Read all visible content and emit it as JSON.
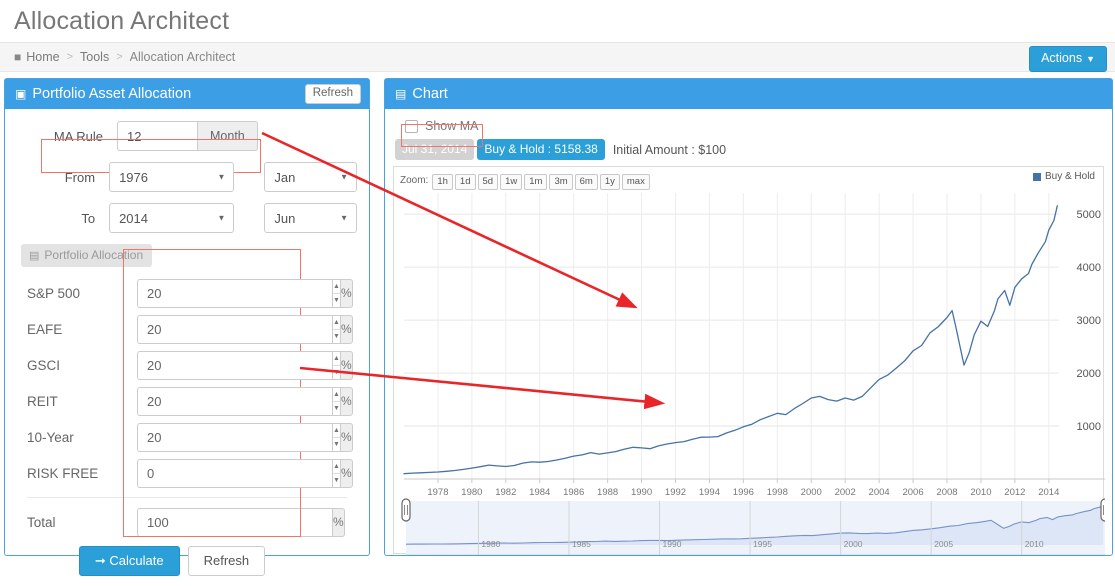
{
  "header": {
    "title": "Allocation Architect",
    "breadcrumb": {
      "home": "Home",
      "tools": "Tools",
      "current": "Allocation Architect",
      "separator": ">"
    },
    "actions_button": "Actions"
  },
  "left_panel": {
    "title": "Portfolio Asset Allocation",
    "refresh_label": "Refresh",
    "ma_rule": {
      "label": "MA Rule",
      "value": "12",
      "unit": "Month"
    },
    "from": {
      "label": "From",
      "year": "1976",
      "month": "Jan"
    },
    "to": {
      "label": "To",
      "year": "2014",
      "month": "Jun"
    },
    "allocation_tab": "Portfolio Allocation",
    "percent_sign": "%",
    "assets": [
      {
        "label": "S&P 500",
        "value": "20"
      },
      {
        "label": "EAFE",
        "value": "20"
      },
      {
        "label": "GSCI",
        "value": "20"
      },
      {
        "label": "REIT",
        "value": "20"
      },
      {
        "label": "10-Year",
        "value": "20"
      },
      {
        "label": "RISK FREE",
        "value": "0"
      }
    ],
    "total": {
      "label": "Total",
      "value": "100"
    },
    "calculate_label": "Calculate",
    "refresh_bottom_label": "Refresh"
  },
  "chart_panel": {
    "title": "Chart",
    "show_ma_label": "Show MA",
    "date_badge": "Jul 31, 2014",
    "result_badge": "Buy & Hold : 5158.38",
    "initial_amount": "Initial Amount : $100",
    "zoom_label": "Zoom:",
    "zoom_options": [
      "1h",
      "1d",
      "5d",
      "1w",
      "1m",
      "3m",
      "6m",
      "1y",
      "max"
    ],
    "legend": "Buy & Hold"
  },
  "colors": {
    "accent": "#2a9fd8",
    "panel_header": "#3c9ee5",
    "series": "#4572a7",
    "annotation": "#f0746a",
    "arrow": "#e8262a"
  },
  "chart_data": {
    "type": "line",
    "title": "Buy & Hold",
    "xlabel": "",
    "ylabel": "",
    "series": [
      {
        "name": "Buy & Hold",
        "color": "#4572a7",
        "points": [
          [
            1976.0,
            100
          ],
          [
            1976.5,
            112
          ],
          [
            1977.0,
            118
          ],
          [
            1977.5,
            124
          ],
          [
            1978.0,
            132
          ],
          [
            1978.5,
            146
          ],
          [
            1979.0,
            160
          ],
          [
            1979.5,
            182
          ],
          [
            1980.0,
            205
          ],
          [
            1980.5,
            232
          ],
          [
            1981.0,
            262
          ],
          [
            1981.5,
            248
          ],
          [
            1982.0,
            236
          ],
          [
            1982.5,
            255
          ],
          [
            1983.0,
            300
          ],
          [
            1983.5,
            322
          ],
          [
            1984.0,
            318
          ],
          [
            1984.5,
            330
          ],
          [
            1985.0,
            358
          ],
          [
            1985.5,
            392
          ],
          [
            1986.0,
            432
          ],
          [
            1986.5,
            455
          ],
          [
            1987.0,
            498
          ],
          [
            1987.5,
            470
          ],
          [
            1988.0,
            492
          ],
          [
            1988.5,
            520
          ],
          [
            1989.0,
            565
          ],
          [
            1989.5,
            598
          ],
          [
            1990.0,
            588
          ],
          [
            1990.5,
            572
          ],
          [
            1991.0,
            625
          ],
          [
            1991.5,
            660
          ],
          [
            1992.0,
            688
          ],
          [
            1992.5,
            706
          ],
          [
            1993.0,
            752
          ],
          [
            1993.5,
            790
          ],
          [
            1994.0,
            792
          ],
          [
            1994.5,
            800
          ],
          [
            1995.0,
            868
          ],
          [
            1995.5,
            920
          ],
          [
            1996.0,
            985
          ],
          [
            1996.5,
            1035
          ],
          [
            1997.0,
            1120
          ],
          [
            1997.5,
            1180
          ],
          [
            1998.0,
            1240
          ],
          [
            1998.5,
            1215
          ],
          [
            1999.0,
            1330
          ],
          [
            1999.5,
            1425
          ],
          [
            2000.0,
            1530
          ],
          [
            2000.5,
            1560
          ],
          [
            2001.0,
            1500
          ],
          [
            2001.5,
            1470
          ],
          [
            2002.0,
            1530
          ],
          [
            2002.5,
            1490
          ],
          [
            2003.0,
            1560
          ],
          [
            2003.5,
            1720
          ],
          [
            2004.0,
            1880
          ],
          [
            2004.5,
            1960
          ],
          [
            2005.0,
            2090
          ],
          [
            2005.5,
            2230
          ],
          [
            2006.0,
            2420
          ],
          [
            2006.5,
            2520
          ],
          [
            2007.0,
            2760
          ],
          [
            2007.5,
            2880
          ],
          [
            2008.0,
            3050
          ],
          [
            2008.3,
            3180
          ],
          [
            2008.5,
            2900
          ],
          [
            2008.8,
            2450
          ],
          [
            2009.0,
            2150
          ],
          [
            2009.3,
            2380
          ],
          [
            2009.6,
            2720
          ],
          [
            2010.0,
            2980
          ],
          [
            2010.4,
            2880
          ],
          [
            2010.8,
            3180
          ],
          [
            2011.0,
            3400
          ],
          [
            2011.4,
            3560
          ],
          [
            2011.7,
            3280
          ],
          [
            2012.0,
            3620
          ],
          [
            2012.4,
            3780
          ],
          [
            2012.8,
            3880
          ],
          [
            2013.0,
            4050
          ],
          [
            2013.4,
            4280
          ],
          [
            2013.8,
            4480
          ],
          [
            2014.0,
            4700
          ],
          [
            2014.3,
            4880
          ],
          [
            2014.5,
            5158
          ]
        ]
      }
    ],
    "yticks": [
      1000,
      2000,
      3000,
      4000,
      5000
    ],
    "ylim": [
      0,
      5400
    ],
    "xticks": [
      1978,
      1980,
      1982,
      1984,
      1986,
      1988,
      1990,
      1992,
      1994,
      1996,
      1998,
      2000,
      2002,
      2004,
      2006,
      2008,
      2010,
      2012,
      2014
    ],
    "xlim": [
      1976,
      2014.6
    ],
    "navigator_xticks": [
      1980,
      1985,
      1990,
      1995,
      2000,
      2005,
      2010
    ],
    "grid": true,
    "legend_position": "top-right",
    "final_value": 5158.38,
    "initial_value": 100,
    "start_date": "1976-01",
    "end_date": "2014-07-31"
  }
}
